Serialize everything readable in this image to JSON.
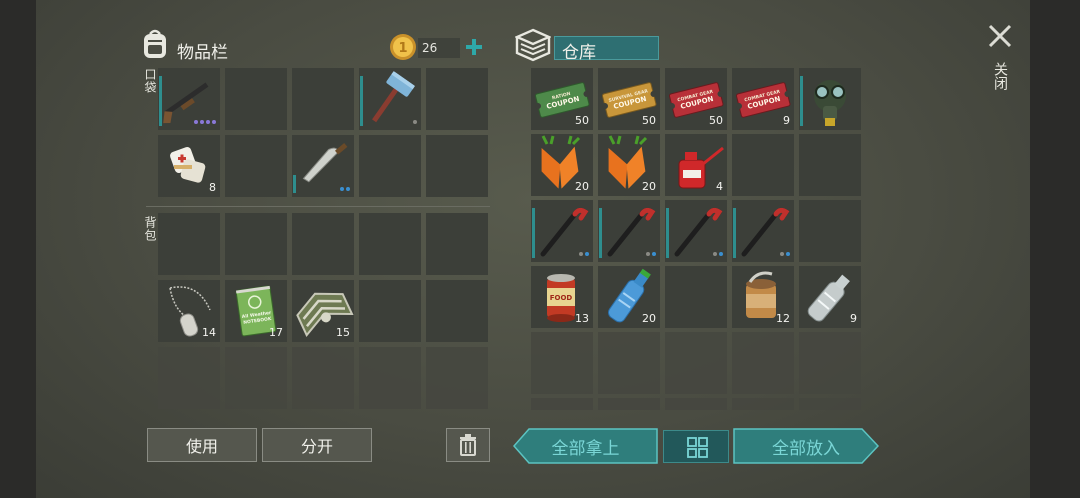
{
  "inventory": {
    "title": "物品栏",
    "coins": "26",
    "pocket_label": "口袋",
    "backpack_label": "背包",
    "pocket_items": [
      {
        "icon": "shotgun-icon",
        "qty": ""
      },
      {
        "icon": "sledgehammer-icon",
        "qty": ""
      },
      {
        "icon": "bandage-icon",
        "qty": "8"
      },
      {
        "icon": "machete-icon",
        "qty": ""
      }
    ],
    "backpack_items": [
      {
        "icon": "dog-tags-icon",
        "qty": "14"
      },
      {
        "icon": "notebook-icon",
        "qty": "17"
      },
      {
        "icon": "chevron-badge-icon",
        "qty": "15"
      }
    ]
  },
  "storage": {
    "title": "仓库",
    "items": [
      {
        "icon": "ration-coupon-icon",
        "qty": "50"
      },
      {
        "icon": "survival-coupon-icon",
        "qty": "50"
      },
      {
        "icon": "combat-coupon-icon",
        "qty": "50"
      },
      {
        "icon": "combat-coupon-icon",
        "qty": "9"
      },
      {
        "icon": "gas-mask-icon",
        "qty": ""
      },
      {
        "icon": "carrot-icon",
        "qty": "20"
      },
      {
        "icon": "carrot-icon",
        "qty": "20"
      },
      {
        "icon": "oil-can-icon",
        "qty": "4"
      },
      {
        "icon": "crowbar-icon",
        "qty": ""
      },
      {
        "icon": "crowbar-icon",
        "qty": ""
      },
      {
        "icon": "crowbar-icon",
        "qty": ""
      },
      {
        "icon": "crowbar-icon",
        "qty": ""
      },
      {
        "icon": "canned-food-icon",
        "qty": "13"
      },
      {
        "icon": "water-bottle-icon",
        "qty": "20"
      },
      {
        "icon": "open-can-icon",
        "qty": "12"
      },
      {
        "icon": "empty-bottle-icon",
        "qty": "9"
      }
    ]
  },
  "coupon_text": {
    "ration_top": "RATION",
    "survival_top": "SURVIVAL GEAR",
    "combat_top": "COMBAT GEAR",
    "coupon": "COUPON"
  },
  "notebook_text": "All Weather NOTEBOOK",
  "food_label": "FOOD",
  "close_label": "关闭",
  "buttons": {
    "use": "使用",
    "split": "分开",
    "take_all": "全部拿上",
    "put_all": "全部放入"
  },
  "colors": {
    "accent": "#2e8e8e",
    "button_teal": "#2f7e7c",
    "rarity_purple": "#8a78d8",
    "rarity_blue": "#3a8fd0"
  }
}
